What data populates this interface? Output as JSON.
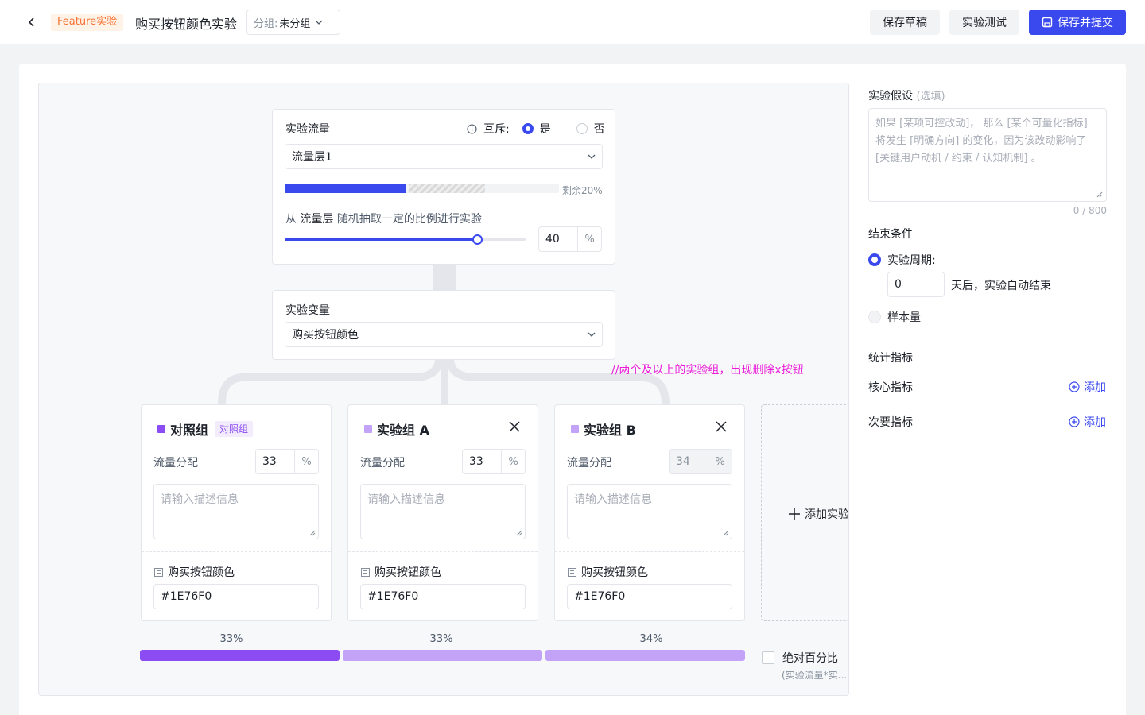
{
  "header": {
    "tag": "Feature实验",
    "title": "购买按钮颜色实验",
    "group_label": "分组:",
    "group_value": "未分组",
    "draft_btn": "保存草稿",
    "test_btn": "实验测试",
    "submit_btn": "保存并提交"
  },
  "traffic": {
    "title": "实验流量",
    "exclusive_label": "互斥:",
    "opt_yes": "是",
    "opt_no": "否",
    "exclusive": "是",
    "layer": "流量层1",
    "remaining": "剩余20%",
    "used_fraction": 0.44,
    "pending_fraction": 0.28,
    "sample_prefix": "从",
    "sample_layer": "流量层",
    "sample_suffix": "随机抽取一定的比例进行实验",
    "sample_value": "40",
    "sample_slider_fraction": 0.8,
    "percent": "%"
  },
  "variable": {
    "title": "实验变量",
    "value": "购买按钮颜色"
  },
  "annotation": "//两个及以上的实验组，出现删除x按钮",
  "groups": [
    {
      "name": "对照组",
      "badge": "对照组",
      "color": "#8b4cf3",
      "alloc_label": "流量分配",
      "alloc_value": "33",
      "desc_placeholder": "请输入描述信息",
      "var_label": "购买按钮颜色",
      "var_value": "#1E76F0"
    },
    {
      "name": "实验组 A",
      "color": "#c2a3f8",
      "alloc_label": "流量分配",
      "alloc_value": "33",
      "desc_placeholder": "请输入描述信息",
      "var_label": "购买按钮颜色",
      "var_value": "#1E76F0"
    },
    {
      "name": "实验组 B",
      "color": "#c2a3f8",
      "alloc_label": "流量分配",
      "alloc_value": "34",
      "desc_placeholder": "请输入描述信息",
      "var_label": "购买按钮颜色",
      "var_value": "#1E76F0"
    }
  ],
  "add_group": "添加实验",
  "distribution": {
    "labels": [
      "33%",
      "33%",
      "34%"
    ],
    "absolute_label": "绝对百分比",
    "absolute_hint": "(实验流量*实..."
  },
  "right": {
    "hypothesis_title": "实验假设",
    "hypothesis_optional": "(选填)",
    "hypothesis_placeholder": "如果 [某项可控改动]， 那么 [某个可量化指标] 将发生 [明确方向] 的变化，因为该改动影响了 [关键用户动机 / 约束 / 认知机制] 。",
    "hypothesis_count": "0 / 800",
    "end_title": "结束条件",
    "period_label": "实验周期:",
    "period_value": "0",
    "period_suffix": "天后，实验自动结束",
    "sample_label": "样本量",
    "metrics_title": "统计指标",
    "core_label": "核心指标",
    "secondary_label": "次要指标",
    "add_label": "添加"
  },
  "colors": {
    "primary": "#3a49ee",
    "annotation": "#e91fd8",
    "control": "#8b4cf3",
    "variant": "#c2a3f8"
  }
}
